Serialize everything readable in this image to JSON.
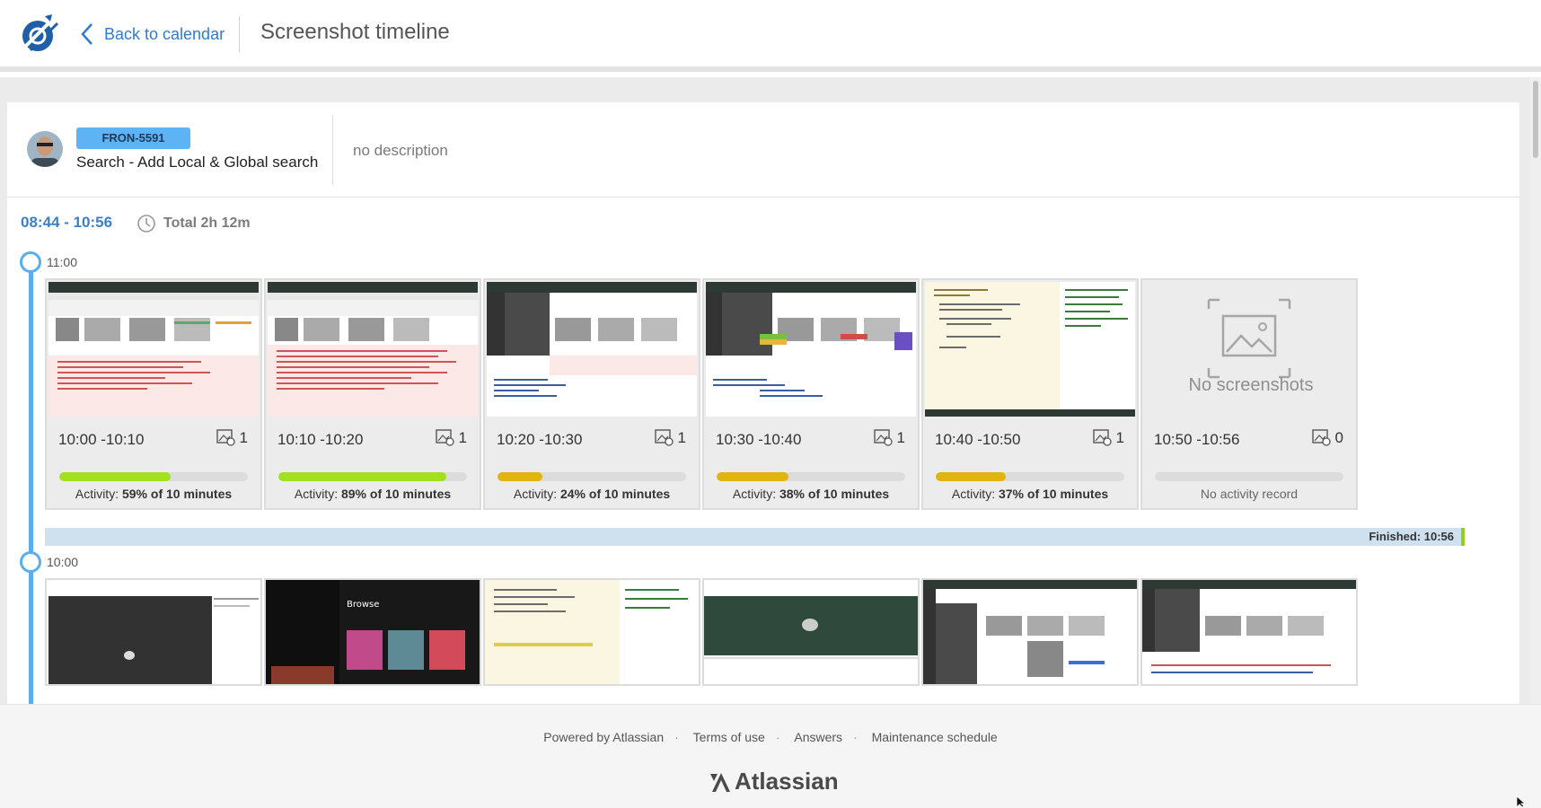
{
  "header": {
    "back_label": "Back to calendar",
    "title": "Screenshot timeline"
  },
  "issue": {
    "key": "FRON-5591",
    "summary": "Search - Add Local & Global search",
    "description": "no description"
  },
  "timeline": {
    "range": "08:44 - 10:56",
    "total": "Total 2h 12m",
    "groups": [
      {
        "hour": "11:00"
      },
      {
        "hour": "10:00"
      }
    ],
    "finished_label": "Finished: 10:56"
  },
  "cards": [
    {
      "period": "10:00 -10:10",
      "count": "1",
      "activity_prefix": "Activity: ",
      "activity_value": "59% of 10 minutes",
      "activity_fraction": 0.59,
      "bar_color": "#a3e01f"
    },
    {
      "period": "10:10 -10:20",
      "count": "1",
      "activity_prefix": "Activity: ",
      "activity_value": "89% of 10 minutes",
      "activity_fraction": 0.89,
      "bar_color": "#a3e01f"
    },
    {
      "period": "10:20 -10:30",
      "count": "1",
      "activity_prefix": "Activity: ",
      "activity_value": "24% of 10 minutes",
      "activity_fraction": 0.24,
      "bar_color": "#e2b40f"
    },
    {
      "period": "10:30 -10:40",
      "count": "1",
      "activity_prefix": "Activity: ",
      "activity_value": "38% of 10 minutes",
      "activity_fraction": 0.38,
      "bar_color": "#e2b40f"
    },
    {
      "period": "10:40 -10:50",
      "count": "1",
      "activity_prefix": "Activity: ",
      "activity_value": "37% of 10 minutes",
      "activity_fraction": 0.37,
      "bar_color": "#e2b40f"
    },
    {
      "period": "10:50 -10:56",
      "count": "0",
      "empty_text": "No screenshots",
      "no_activity": "No activity record",
      "activity_fraction": 0
    }
  ],
  "footer": {
    "links": [
      "Powered by Atlassian",
      "Terms of use",
      "Answers",
      "Maintenance schedule"
    ],
    "brand": "Atlassian"
  },
  "icons": {
    "logo": "tempo-logo-icon",
    "back": "chevron-left-icon",
    "clock": "clock-icon",
    "image_count": "image-icon",
    "placeholder": "image-placeholder-icon"
  },
  "colors": {
    "accent": "#2f7bd3",
    "timeline": "#5aaef0",
    "issue_key_bg": "#5db3f3",
    "activity_high": "#a3e01f",
    "activity_low": "#e2b40f",
    "finished_bg": "#cfe1ef",
    "finished_end": "#8fd11b"
  }
}
